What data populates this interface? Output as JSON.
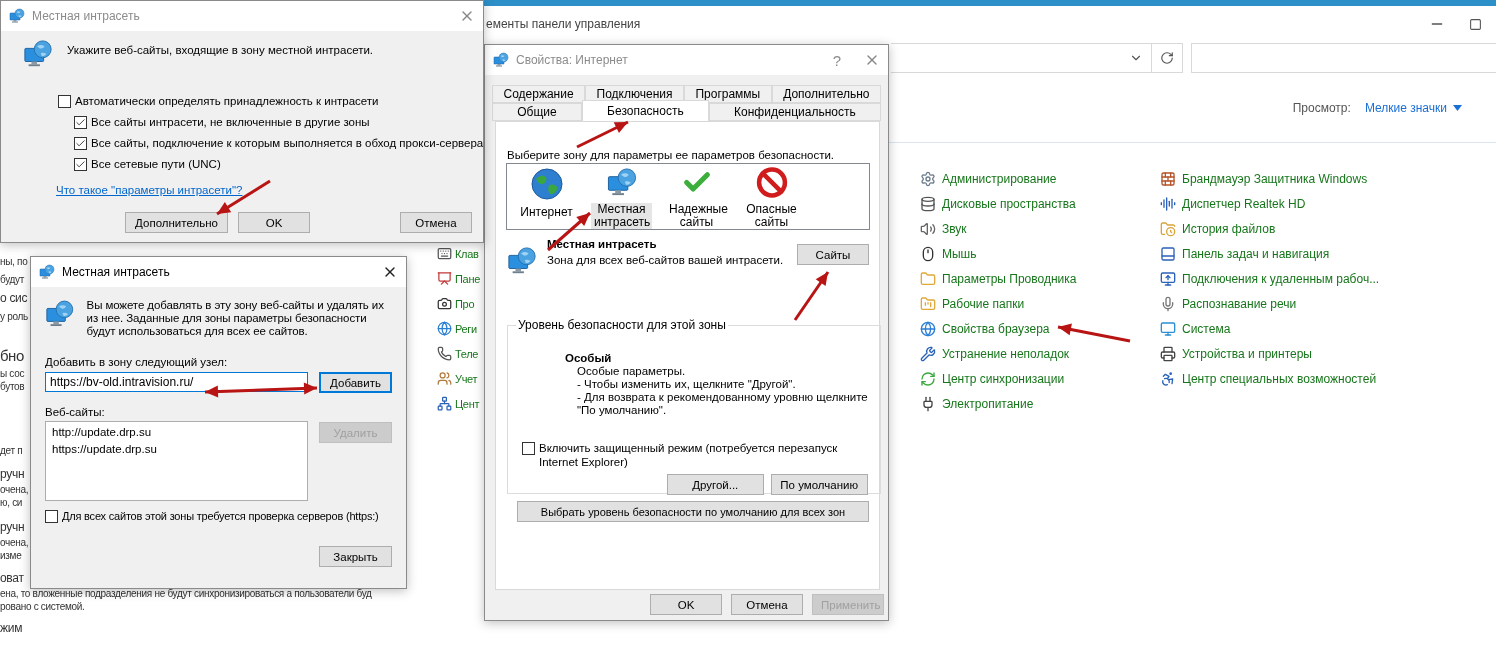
{
  "control_panel": {
    "title": "ементы панели управления",
    "view_label": "Просмотр:",
    "view_value": "Мелкие значки",
    "partial_items": [
      {
        "label": "Клав"
      },
      {
        "label": "Пане"
      },
      {
        "label": "Про"
      },
      {
        "label": "Реги"
      },
      {
        "label": "Теле"
      },
      {
        "label": "Учет"
      },
      {
        "label": "Цент"
      }
    ],
    "items_column_1": [
      {
        "label": "Администрирование"
      },
      {
        "label": "Дисковые пространства"
      },
      {
        "label": "Звук"
      },
      {
        "label": "Мышь"
      },
      {
        "label": "Параметры Проводника"
      },
      {
        "label": "Рабочие папки"
      },
      {
        "label": "Свойства браузера"
      },
      {
        "label": "Устранение неполадок"
      },
      {
        "label": "Центр синхронизации"
      },
      {
        "label": "Электропитание"
      }
    ],
    "items_column_2": [
      {
        "label": "Брандмауэр Защитника Windows"
      },
      {
        "label": "Диспетчер Realtek HD"
      },
      {
        "label": "История файлов"
      },
      {
        "label": "Панель задач и навигация"
      },
      {
        "label": "Подключения к удаленным рабоч..."
      },
      {
        "label": "Распознавание речи"
      },
      {
        "label": "Система"
      },
      {
        "label": "Устройства и принтеры"
      },
      {
        "label": "Центр специальных возможностей"
      }
    ]
  },
  "background_app": {
    "lines": [
      {
        "text": "ны, по",
        "kind": "text"
      },
      {
        "text": "будут",
        "kind": "text"
      },
      {
        "text": "о сис",
        "kind": "medium"
      },
      {
        "text": "у роль",
        "kind": "text"
      },
      {
        "text": "бно",
        "kind": "heading"
      },
      {
        "text": "ы сос",
        "kind": "text"
      },
      {
        "text": "бутов",
        "kind": "text"
      },
      {
        "text": "дет п",
        "kind": "text"
      },
      {
        "text": "ручн",
        "kind": "medium"
      },
      {
        "text": "очена,",
        "kind": "text"
      },
      {
        "text": "ю, си",
        "kind": "text"
      },
      {
        "text": "ручн",
        "kind": "medium"
      },
      {
        "text": "очена,",
        "kind": "text"
      },
      {
        "text": "изме",
        "kind": "text"
      },
      {
        "text": "оват",
        "kind": "medium"
      },
      {
        "text": "ена, то вложенные подразделения не будут синхронизироваться а пользователи буд",
        "kind": "text"
      },
      {
        "text": "ровано с системой.",
        "kind": "text"
      },
      {
        "text": "жим",
        "kind": "medium"
      }
    ]
  },
  "internet_properties": {
    "title": "Свойства: Интернет",
    "help": "?",
    "tabs_row_1": [
      {
        "label": "Содержание",
        "selected": false
      },
      {
        "label": "Подключения",
        "selected": false
      },
      {
        "label": "Программы",
        "selected": false
      },
      {
        "label": "Дополнительно",
        "selected": false
      }
    ],
    "tabs_row_2": [
      {
        "label": "Общие",
        "selected": false
      },
      {
        "label": "Безопасность",
        "selected": true
      },
      {
        "label": "Конфиденциальность",
        "selected": false
      }
    ],
    "zone_prompt": "Выберите зону для параметры ее параметров безопасности.",
    "zones": [
      {
        "label": "Интернет",
        "kind": "internet",
        "selected": false
      },
      {
        "label": "Местная интрасеть",
        "kind": "intranet",
        "selected": true
      },
      {
        "label": "Надежные сайты",
        "kind": "trusted",
        "selected": false
      },
      {
        "label": "Опасные сайты",
        "kind": "restricted",
        "selected": false
      }
    ],
    "zone_name": "Местная интрасеть",
    "zone_description": "Зона для всех веб-сайтов вашей интрасети.",
    "sites_button": "Сайты",
    "security_level": {
      "legend": "Уровень безопасности для этой зоны",
      "level_name": "Особый",
      "lines": [
        "Особые параметры.",
        "- Чтобы изменить их, щелкните \"Другой\".",
        "- Для возврата к рекомендованному уровню щелкните",
        "\"По умолчанию\"."
      ],
      "protected_mode": {
        "label": "Включить защищенный режим (потребуется перезапуск Internet Explorer)",
        "checked": false
      },
      "buttons": [
        {
          "label": "Другой..."
        },
        {
          "label": "По умолчанию"
        }
      ]
    },
    "reset_all_button": "Выбрать уровень безопасности по умолчанию для всех зон",
    "buttons": [
      {
        "label": "OK",
        "disabled": false
      },
      {
        "label": "Отмена",
        "disabled": false
      },
      {
        "label": "Применить",
        "disabled": true
      }
    ]
  },
  "intranet_settings": {
    "title": "Местная интрасеть",
    "prompt": "Укажите веб-сайты, входящие в зону местной интрасети.",
    "options": [
      {
        "label": "Автоматически определять принадлежность к интрасети",
        "checked": false,
        "children": [
          {
            "label": "Все сайты интрасети, не включенные в другие зоны",
            "checked": true
          },
          {
            "label": "Все сайты, подключение к которым выполняется в обход прокси-сервера",
            "checked": true
          },
          {
            "label": "Все сетевые пути (UNC)",
            "checked": true
          }
        ]
      }
    ],
    "link": "Что такое \"параметры интрасети\"?",
    "buttons": [
      {
        "label": "Дополнительно"
      },
      {
        "label": "OK"
      },
      {
        "label": "Отмена"
      }
    ]
  },
  "intranet_sites": {
    "title": "Местная интрасеть",
    "description": "Вы можете добавлять в эту зону  веб-сайты и удалять их из нее. Заданные для зоны параметры безопасности будут использоваться для всех ее сайтов.",
    "add_label": "Добавить в зону следующий узел:",
    "add_value": "https://bv-old.intravision.ru/",
    "add_button": {
      "label": "Добавить",
      "focused": true
    },
    "sites_label": "Веб-сайты:",
    "sites": [
      "http://update.drp.su",
      "https://update.drp.su"
    ],
    "remove_button": {
      "label": "Удалить",
      "disabled": true
    },
    "https_check": {
      "label": "Для всех сайтов этой зоны требуется проверка серверов (https:)",
      "checked": false
    },
    "close_button": "Закрыть"
  }
}
